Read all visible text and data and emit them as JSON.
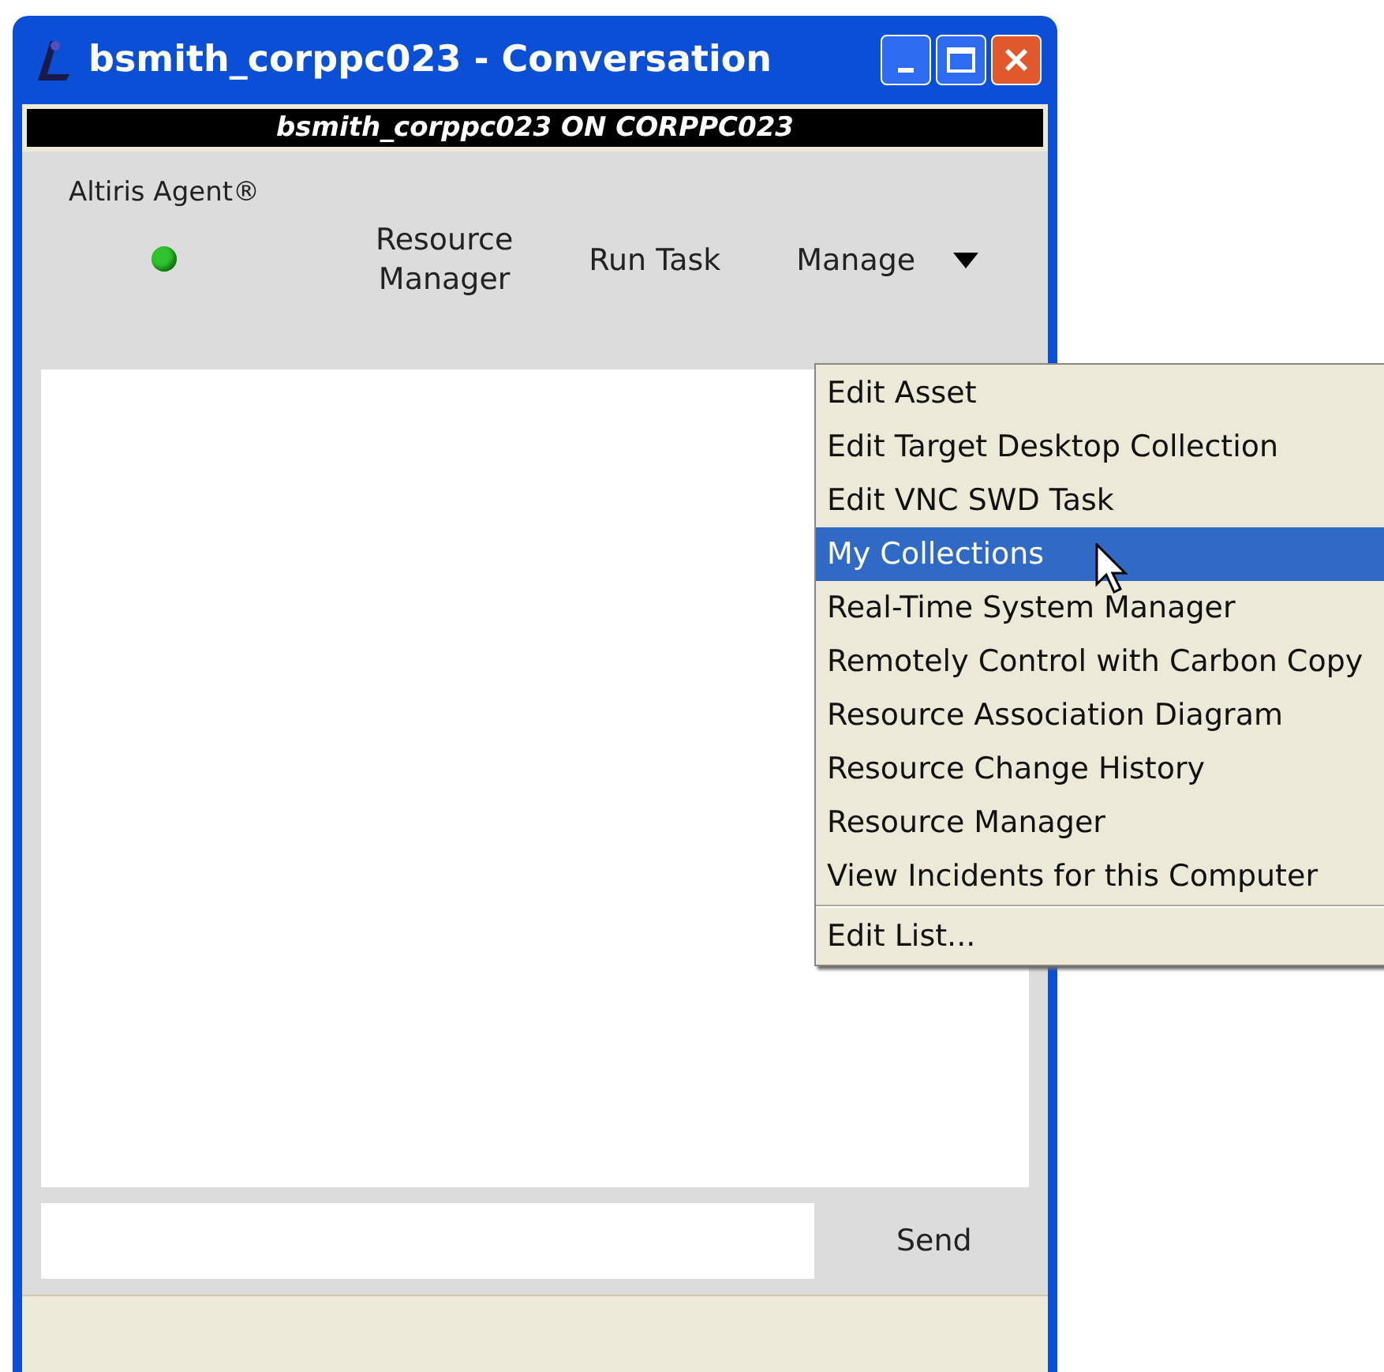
{
  "window": {
    "title": "bsmith_corppc023 - Conversation"
  },
  "header": {
    "text": "bsmith_corppc023 ON CORPPC023"
  },
  "agent": {
    "label": "Altiris Agent®",
    "online": true
  },
  "toolbar": [
    {
      "label": "Resource\nManager",
      "kind": "button"
    },
    {
      "label": "Run Task",
      "kind": "button"
    },
    {
      "label": "Manage",
      "kind": "dropdown"
    }
  ],
  "menu": {
    "items": [
      {
        "label": "Edit Asset",
        "selected": false
      },
      {
        "label": "Edit Target Desktop Collection",
        "selected": false
      },
      {
        "label": "Edit VNC SWD Task",
        "selected": false
      },
      {
        "label": "My Collections",
        "selected": true
      },
      {
        "label": "Real-Time System Manager",
        "selected": false
      },
      {
        "label": "Remotely Control with Carbon Copy",
        "selected": false
      },
      {
        "label": "Resource Association Diagram",
        "selected": false
      },
      {
        "label": "Resource Change History",
        "selected": false
      },
      {
        "label": "Resource Manager",
        "selected": false
      },
      {
        "label": "View Incidents for this Computer",
        "selected": false
      }
    ],
    "footer_items": [
      {
        "label": "Edit List..."
      }
    ]
  },
  "send_button": {
    "label": "Send"
  }
}
